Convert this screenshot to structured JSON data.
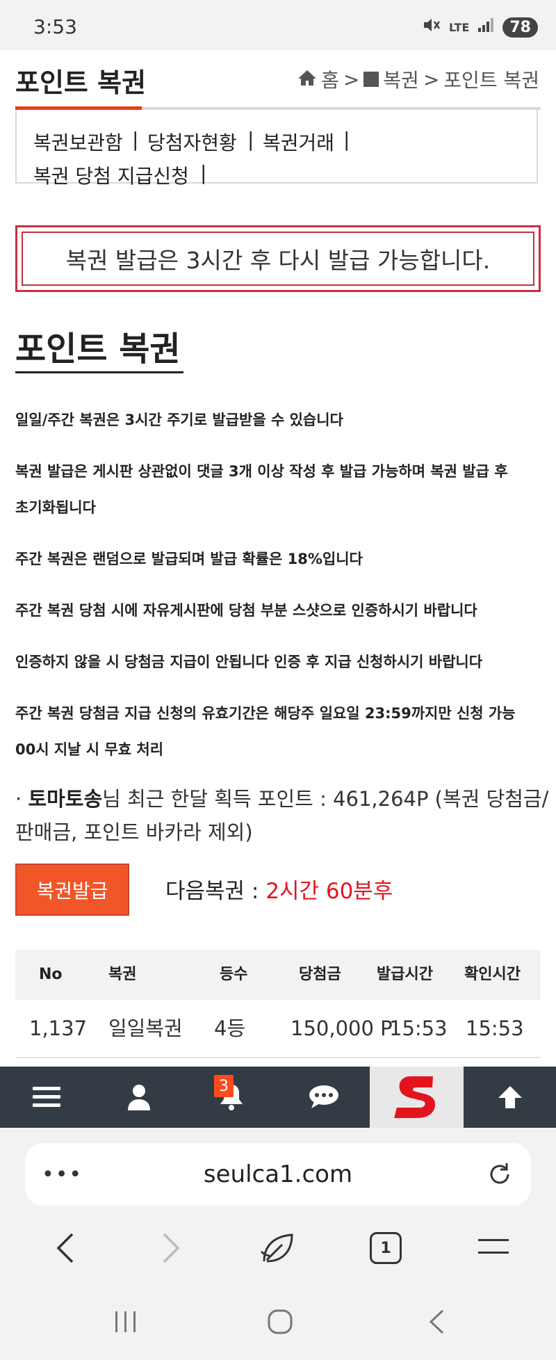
{
  "status_bar": {
    "time": "3:53",
    "network": "LTE",
    "battery": "78",
    "icons": [
      "mute-icon",
      "signal-icon"
    ]
  },
  "header": {
    "title": "포인트 복권",
    "breadcrumb": {
      "home": "홈",
      "sep": ">",
      "section": "복권",
      "current": "포인트 복권"
    },
    "accent_color": "#e8401c"
  },
  "submenu": {
    "items": [
      "복권보관함",
      "당첨자현황",
      "복권거래",
      "복권 당첨 지급신청"
    ],
    "separator": "|"
  },
  "alert": {
    "message": "복권 발급은 3시간 후 다시 발급 가능합니다.",
    "border_color": "#c8303e"
  },
  "section": {
    "title": "포인트 복권",
    "notices": [
      "일일/주간 복권은 3시간 주기로 발급받을 수 있습니다",
      "복권 발급은 게시판 상관없이 댓글 3개 이상 작성 후 발급 가능하며 복권 발급 후",
      "초기화됩니다",
      "주간 복권은 랜덤으로 발급되며 발급 확률은 18%입니다",
      "주간 복권 당첨 시에 자유게시판에 당첨 부분 스샷으로 인증하시기 바랍니다",
      "인증하지 않을 시 당첨금 지급이 안됩니다 인증 후 지급 신청하시기 바랍니다",
      "주간 복권 당첨금 지급 신청의 유효기간은 해당주 일요일 23:59까지만 신청 가능",
      "00시 지날 시 무효 처리"
    ]
  },
  "stats": {
    "bullet": "·",
    "user": "토마토송",
    "line1_rest": "님 최근 한달 획득 포인트 : 461,264P (복권 당첨금/",
    "line2": "판매금, 포인트 바카라 제외)"
  },
  "issue": {
    "button_label": "복권발급",
    "button_color": "#f05628",
    "next_label": "다음복권 : ",
    "next_value": "2시간 60분후",
    "next_color": "#e3141e"
  },
  "table": {
    "headers": [
      "No",
      "복권",
      "등수",
      "당첨금",
      "발급시간",
      "확인시간"
    ],
    "rows": [
      [
        "1,137",
        "일일복권",
        "4등",
        "150,000 P",
        "15:53",
        "15:53"
      ]
    ]
  },
  "bottom_nav": {
    "items": [
      "menu-icon",
      "user-icon",
      "bell-icon",
      "chat-icon",
      "site-logo",
      "arrow-up-icon"
    ],
    "notification_count": "3",
    "background": "#333b44"
  },
  "browser": {
    "url": "seulca1.com",
    "menu": "•••",
    "tab_count": "1"
  }
}
